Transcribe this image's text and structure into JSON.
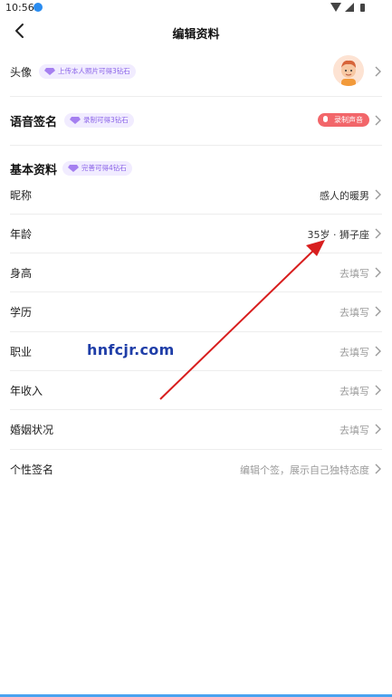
{
  "status_bar": {
    "time": "10:56"
  },
  "header": {
    "title": "编辑资料"
  },
  "avatar_row": {
    "label": "头像",
    "badge": "上传本人照片可得3钻石"
  },
  "voice_row": {
    "label": "语音签名",
    "badge": "录制可得3钻石",
    "button": "录制声音"
  },
  "basic_section": {
    "label": "基本资料",
    "badge": "完善可得4钻石"
  },
  "fields": [
    {
      "label": "昵称",
      "value": "感人的暖男"
    },
    {
      "label": "年龄",
      "value": "35岁 · 狮子座"
    },
    {
      "label": "身高",
      "value": "去填写"
    },
    {
      "label": "学历",
      "value": "去填写"
    },
    {
      "label": "职业",
      "value": "去填写"
    },
    {
      "label": "年收入",
      "value": "去填写"
    },
    {
      "label": "婚姻状况",
      "value": "去填写"
    },
    {
      "label": "个性签名",
      "value": "编辑个签，展示自己独特态度"
    }
  ],
  "watermark": "hnfcjr.com",
  "colors": {
    "accent_purple": "#8a63e8",
    "badge_bg": "#f1ecff",
    "record_red": "#f2666a",
    "arrow_red": "#d81e1e",
    "hint_gray": "#9a9a9a"
  }
}
